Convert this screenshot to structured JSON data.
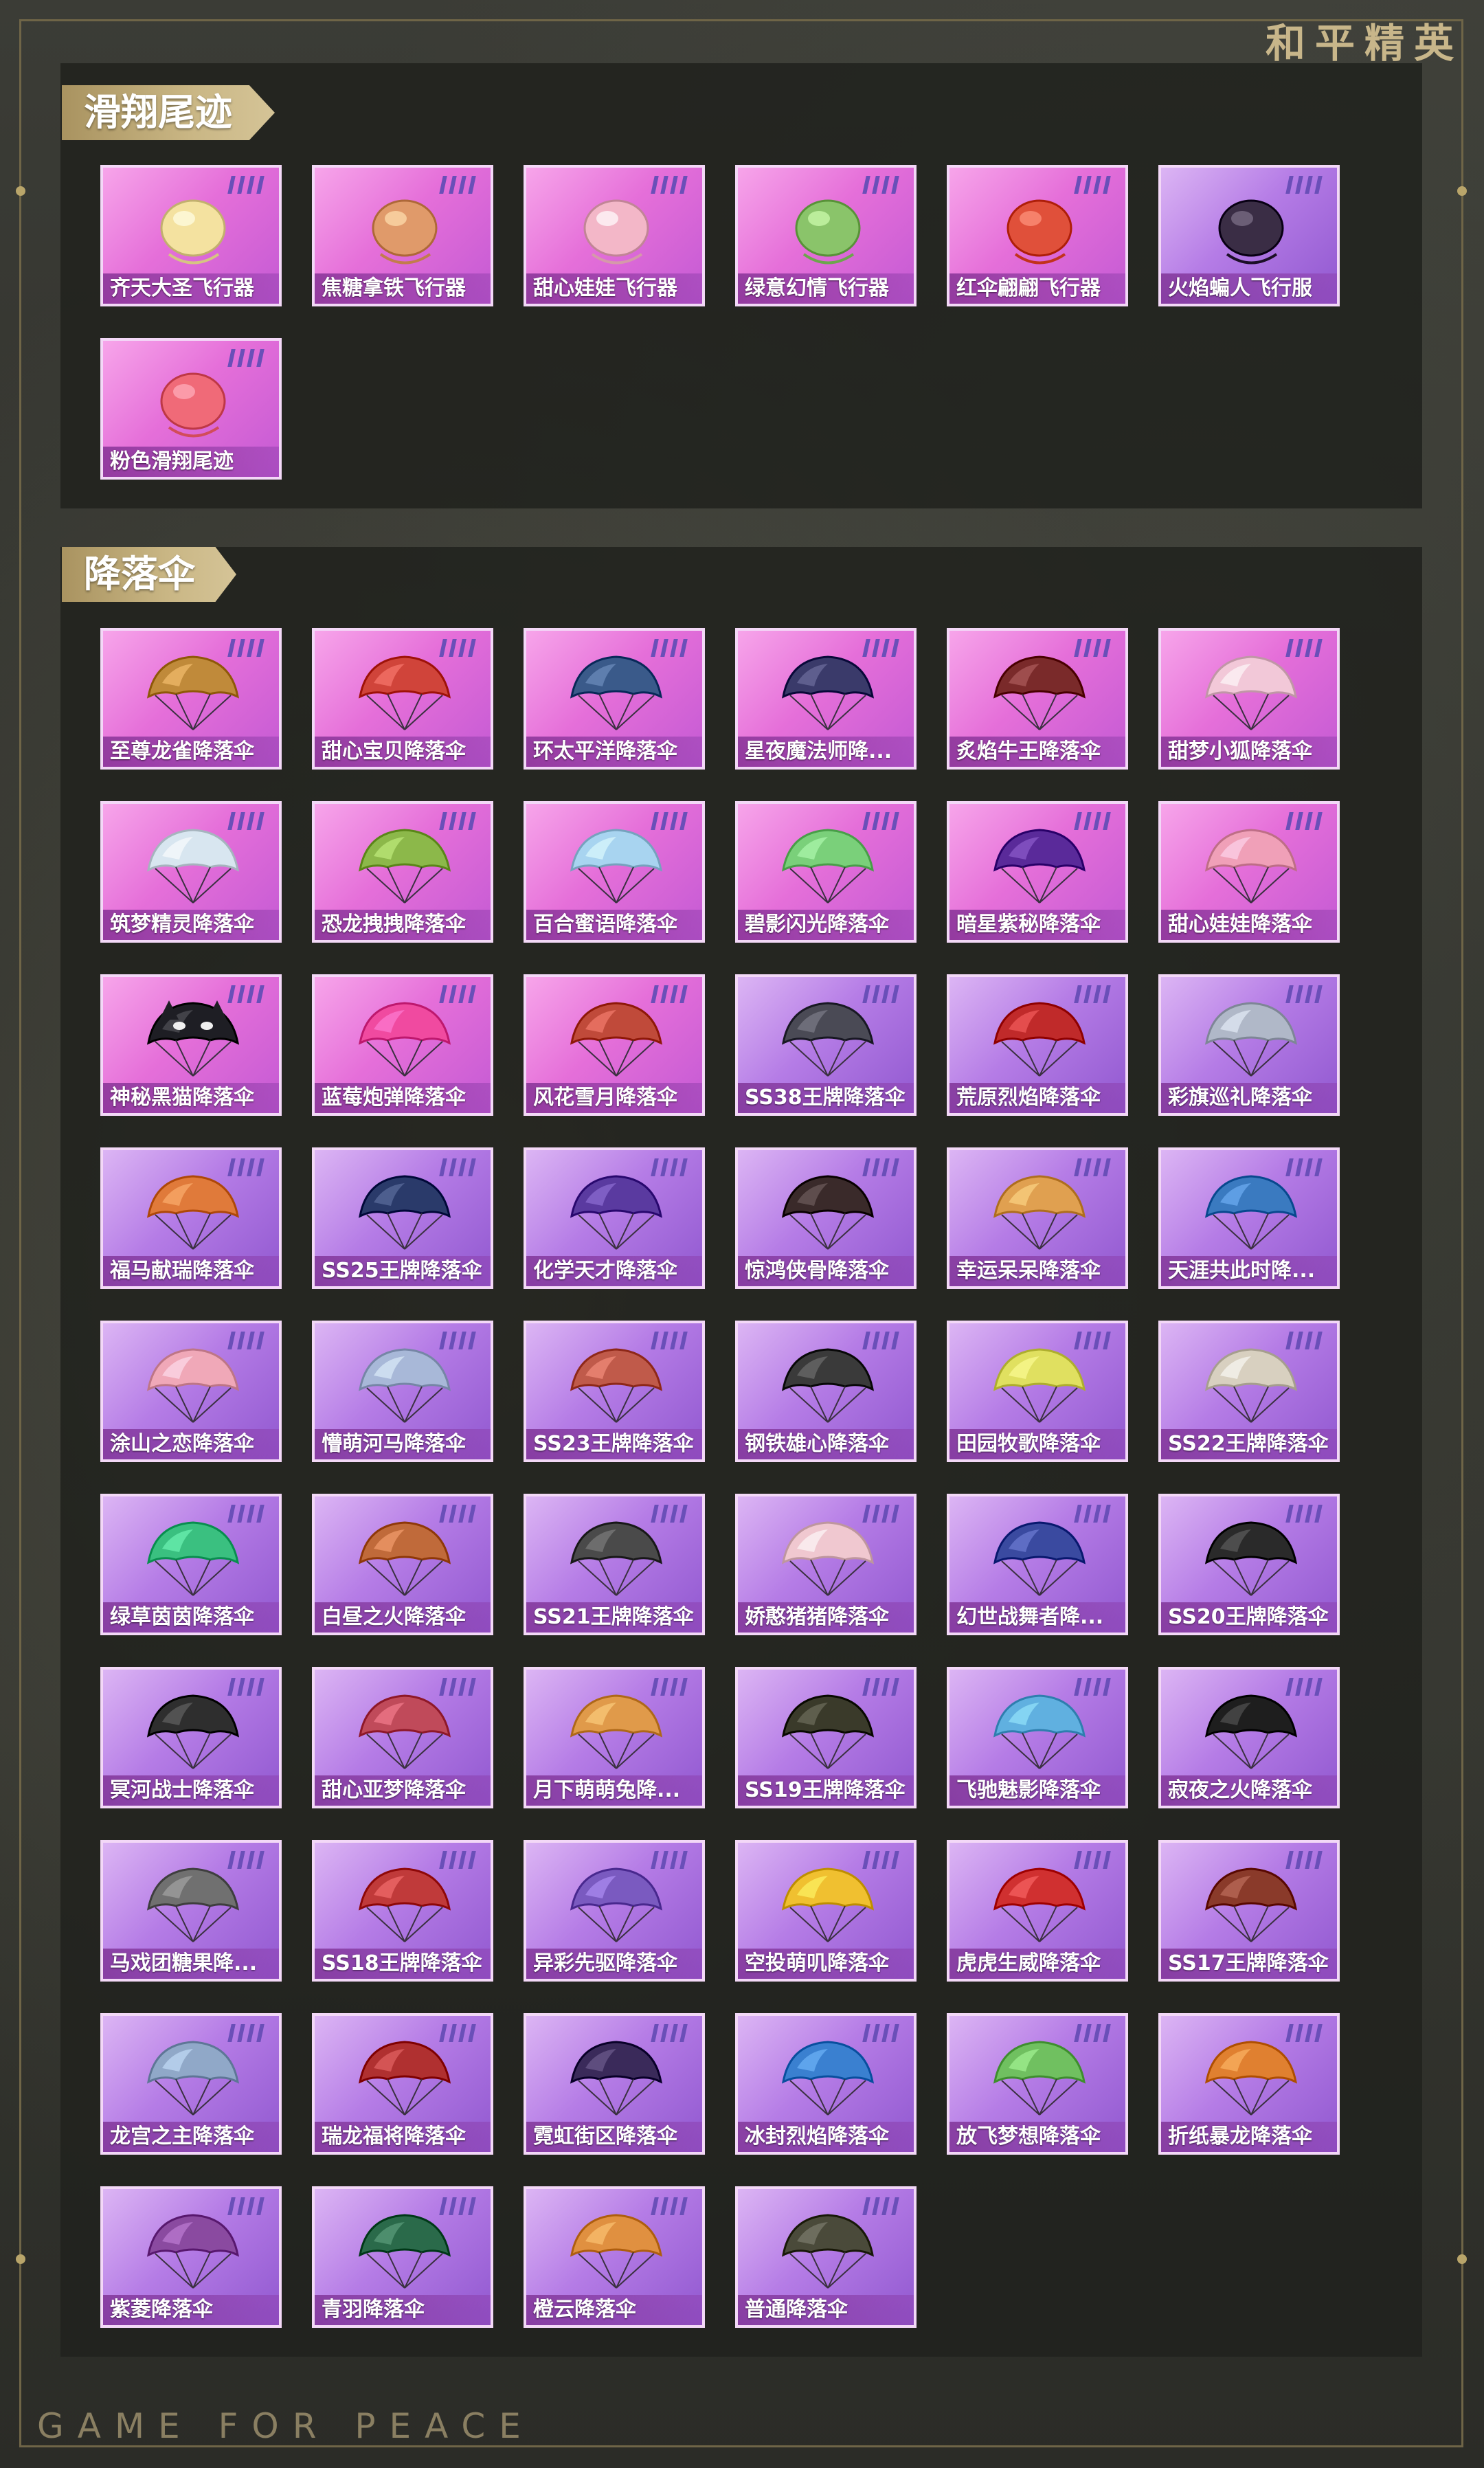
{
  "brand": {
    "cn": "和平精英",
    "en": "GAME FOR PEACE"
  },
  "sections": [
    {
      "title": "滑翔尾迹",
      "items": [
        {
          "name": "齐天大圣飞行器",
          "tier": "pink",
          "icon": "golden-cloud-glider-icon",
          "color": "#f4e2a0"
        },
        {
          "name": "焦糖拿铁飞行器",
          "tier": "pink",
          "icon": "latte-glider-icon",
          "color": "#e09a6a"
        },
        {
          "name": "甜心娃娃飞行器",
          "tier": "pink",
          "icon": "doll-glider-icon",
          "color": "#f3b7c8"
        },
        {
          "name": "绿意幻情飞行器",
          "tier": "pink",
          "icon": "cactus-glider-icon",
          "color": "#8ac46a"
        },
        {
          "name": "红伞翩翩飞行器",
          "tier": "pink",
          "icon": "umbrella-glider-icon",
          "color": "#e0503a"
        },
        {
          "name": "火焰蝙人飞行服",
          "tier": "purple",
          "icon": "bat-suit-icon",
          "color": "#3a2d45"
        },
        {
          "name": "粉色滑翔尾迹",
          "tier": "pink",
          "icon": "pink-trail-icon",
          "color": "#f06a78"
        }
      ]
    },
    {
      "title": "降落伞",
      "items": [
        {
          "name": "至尊龙雀降落伞",
          "tier": "pink",
          "icon": "parachute-icon",
          "color": "#c08a3a"
        },
        {
          "name": "甜心宝贝降落伞",
          "tier": "pink",
          "icon": "parachute-icon",
          "color": "#d0443a"
        },
        {
          "name": "环太平洋降落伞",
          "tier": "pink",
          "icon": "parachute-icon",
          "color": "#3a5a8a"
        },
        {
          "name": "星夜魔法师降...",
          "tier": "pink",
          "icon": "parachute-icon",
          "color": "#3a3a6a"
        },
        {
          "name": "炙焰牛王降落伞",
          "tier": "pink",
          "icon": "parachute-icon",
          "color": "#7a2a2a"
        },
        {
          "name": "甜梦小狐降落伞",
          "tier": "pink",
          "icon": "parachute-icon",
          "color": "#f2c8d8"
        },
        {
          "name": "筑梦精灵降落伞",
          "tier": "pink",
          "icon": "parachute-icon",
          "color": "#d8e6f0"
        },
        {
          "name": "恐龙拽拽降落伞",
          "tier": "pink",
          "icon": "parachute-icon",
          "color": "#8cb84a"
        },
        {
          "name": "百合蜜语降落伞",
          "tier": "pink",
          "icon": "parachute-icon",
          "color": "#a8d4f0"
        },
        {
          "name": "碧影闪光降落伞",
          "tier": "pink",
          "icon": "parachute-icon",
          "color": "#7ad07a"
        },
        {
          "name": "暗星紫秘降落伞",
          "tier": "pink",
          "icon": "parachute-icon",
          "color": "#5a2a9a"
        },
        {
          "name": "甜心娃娃降落伞",
          "tier": "pink",
          "icon": "parachute-icon",
          "color": "#f0a0b8"
        },
        {
          "name": "神秘黑猫降落伞",
          "tier": "pink",
          "icon": "black-cat-parachute-icon",
          "color": "#1e1e24"
        },
        {
          "name": "蓝莓炮弹降落伞",
          "tier": "pink",
          "icon": "parachute-icon",
          "color": "#f04aa0"
        },
        {
          "name": "风花雪月降落伞",
          "tier": "pink",
          "icon": "parachute-icon",
          "color": "#c04a3a"
        },
        {
          "name": "SS38王牌降落伞",
          "tier": "purple",
          "icon": "parachute-icon",
          "color": "#4a4a55"
        },
        {
          "name": "荒原烈焰降落伞",
          "tier": "purple",
          "icon": "parachute-icon",
          "color": "#c02a2a"
        },
        {
          "name": "彩旗巡礼降落伞",
          "tier": "purple",
          "icon": "parachute-icon",
          "color": "#b0b8c8"
        },
        {
          "name": "福马献瑞降落伞",
          "tier": "purple",
          "icon": "parachute-icon",
          "color": "#e07a3a"
        },
        {
          "name": "SS25王牌降落伞",
          "tier": "purple",
          "icon": "parachute-icon",
          "color": "#2a3a6a"
        },
        {
          "name": "化学天才降落伞",
          "tier": "purple",
          "icon": "parachute-icon",
          "color": "#5a3aa0"
        },
        {
          "name": "惊鸿侠骨降落伞",
          "tier": "purple",
          "icon": "parachute-icon",
          "color": "#3a2a2a"
        },
        {
          "name": "幸运呆呆降落伞",
          "tier": "purple",
          "icon": "parachute-icon",
          "color": "#e0a050"
        },
        {
          "name": "天涯共此时降...",
          "tier": "purple",
          "icon": "parachute-icon",
          "color": "#3a7ac0"
        },
        {
          "name": "涂山之恋降落伞",
          "tier": "purple",
          "icon": "parachute-icon",
          "color": "#f0a8b8"
        },
        {
          "name": "懵萌河马降落伞",
          "tier": "purple",
          "icon": "parachute-icon",
          "color": "#a8b8d8"
        },
        {
          "name": "SS23王牌降落伞",
          "tier": "purple",
          "icon": "parachute-icon",
          "color": "#c05a4a"
        },
        {
          "name": "钢铁雄心降落伞",
          "tier": "purple",
          "icon": "parachute-icon",
          "color": "#3a3a3a"
        },
        {
          "name": "田园牧歌降落伞",
          "tier": "purple",
          "icon": "parachute-icon",
          "color": "#e0e060"
        },
        {
          "name": "SS22王牌降落伞",
          "tier": "purple",
          "icon": "parachute-icon",
          "color": "#d8d0c0"
        },
        {
          "name": "绿草茵茵降落伞",
          "tier": "purple",
          "icon": "parachute-icon",
          "color": "#3ac080"
        },
        {
          "name": "白昼之火降落伞",
          "tier": "purple",
          "icon": "parachute-icon",
          "color": "#c06a3a"
        },
        {
          "name": "SS21王牌降落伞",
          "tier": "purple",
          "icon": "parachute-icon",
          "color": "#4a4a4a"
        },
        {
          "name": "娇憨猪猪降落伞",
          "tier": "purple",
          "icon": "parachute-icon",
          "color": "#f0c8d0"
        },
        {
          "name": "幻世战舞者降...",
          "tier": "purple",
          "icon": "parachute-icon",
          "color": "#3a4aa0"
        },
        {
          "name": "SS20王牌降落伞",
          "tier": "purple",
          "icon": "parachute-icon",
          "color": "#2a2a2a"
        },
        {
          "name": "冥河战士降落伞",
          "tier": "purple",
          "icon": "parachute-icon",
          "color": "#2e2e2e"
        },
        {
          "name": "甜心亚梦降落伞",
          "tier": "purple",
          "icon": "parachute-icon",
          "color": "#c04a5a"
        },
        {
          "name": "月下萌萌兔降...",
          "tier": "purple",
          "icon": "parachute-icon",
          "color": "#e09a4a"
        },
        {
          "name": "SS19王牌降落伞",
          "tier": "purple",
          "icon": "parachute-icon",
          "color": "#3a3a2a"
        },
        {
          "name": "飞驰魅影降落伞",
          "tier": "purple",
          "icon": "parachute-icon",
          "color": "#60b0e0"
        },
        {
          "name": "寂夜之火降落伞",
          "tier": "purple",
          "icon": "parachute-icon",
          "color": "#1e1e1e"
        },
        {
          "name": "马戏团糖果降...",
          "tier": "purple",
          "icon": "parachute-icon",
          "color": "#707070"
        },
        {
          "name": "SS18王牌降落伞",
          "tier": "purple",
          "icon": "parachute-icon",
          "color": "#c03a3a"
        },
        {
          "name": "异彩先驱降落伞",
          "tier": "purple",
          "icon": "parachute-icon",
          "color": "#7a5ac0"
        },
        {
          "name": "空投萌叽降落伞",
          "tier": "purple",
          "icon": "parachute-icon",
          "color": "#f0c030"
        },
        {
          "name": "虎虎生威降落伞",
          "tier": "purple",
          "icon": "parachute-icon",
          "color": "#d03030"
        },
        {
          "name": "SS17王牌降落伞",
          "tier": "purple",
          "icon": "parachute-icon",
          "color": "#8a3a2a"
        },
        {
          "name": "龙宫之主降落伞",
          "tier": "purple",
          "icon": "parachute-icon",
          "color": "#90a8c8"
        },
        {
          "name": "瑞龙福将降落伞",
          "tier": "purple",
          "icon": "parachute-icon",
          "color": "#b03030"
        },
        {
          "name": "霓虹街区降落伞",
          "tier": "purple",
          "icon": "parachute-icon",
          "color": "#3a2a5a"
        },
        {
          "name": "冰封烈焰降落伞",
          "tier": "purple",
          "icon": "parachute-icon",
          "color": "#3a80d0"
        },
        {
          "name": "放飞梦想降落伞",
          "tier": "purple",
          "icon": "parachute-icon",
          "color": "#70c060"
        },
        {
          "name": "折纸暴龙降落伞",
          "tier": "purple",
          "icon": "parachute-icon",
          "color": "#e08030"
        },
        {
          "name": "紫菱降落伞",
          "tier": "purple",
          "icon": "parachute-icon",
          "color": "#8a4aa0"
        },
        {
          "name": "青羽降落伞",
          "tier": "purple",
          "icon": "parachute-icon",
          "color": "#2a6a4a"
        },
        {
          "name": "橙云降落伞",
          "tier": "purple",
          "icon": "parachute-icon",
          "color": "#e09040"
        },
        {
          "name": "普通降落伞",
          "tier": "purple",
          "icon": "parachute-icon",
          "color": "#4a4a3a"
        }
      ]
    }
  ]
}
